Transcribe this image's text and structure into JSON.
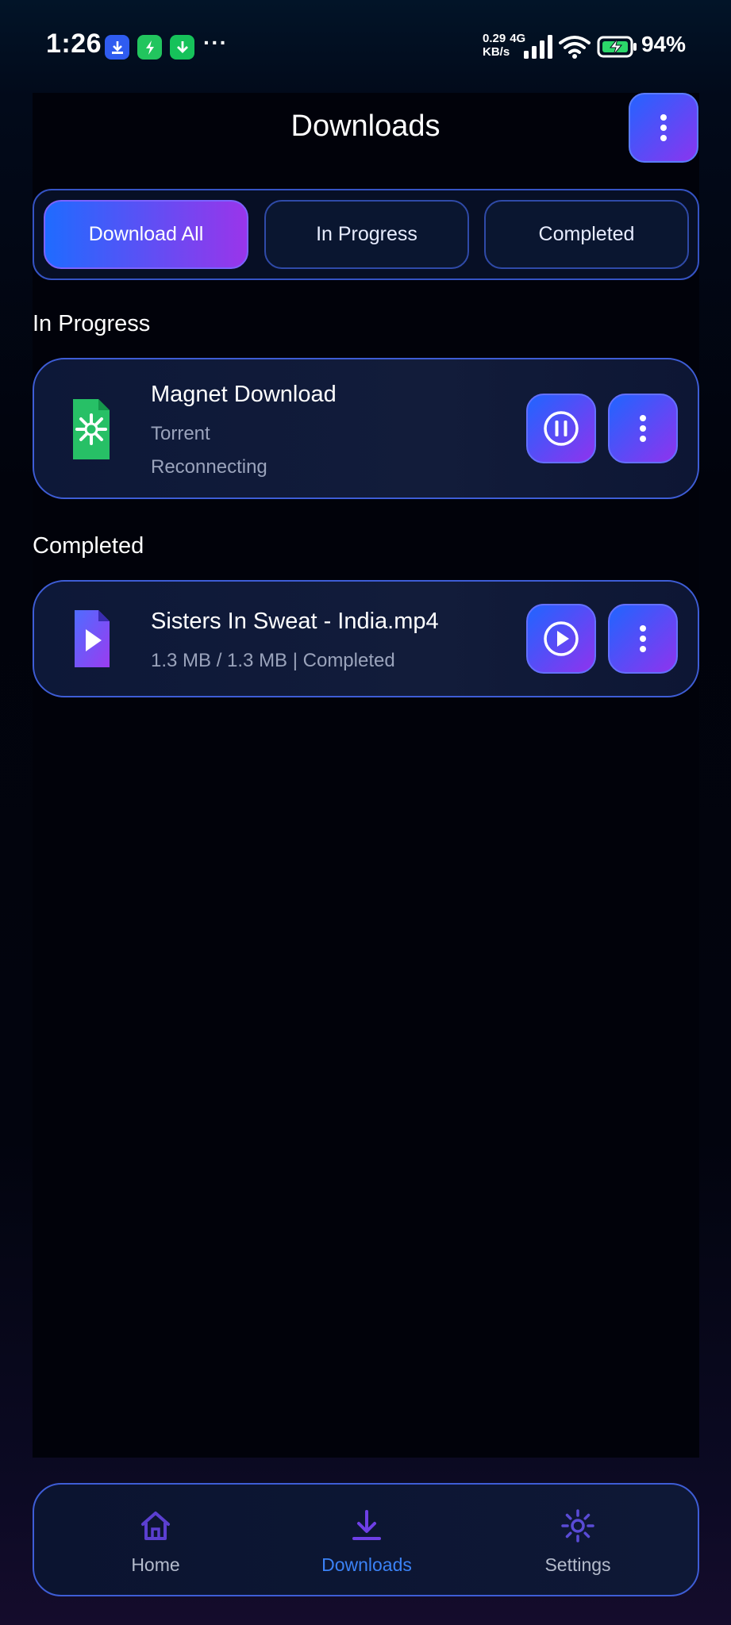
{
  "status_bar": {
    "time": "1:26",
    "overflow": "···",
    "net_speed_value": "0.29",
    "net_speed_unit": "KB/s",
    "network_type": "4G",
    "battery": "94%"
  },
  "header": {
    "title": "Downloads",
    "menu_icon": "more-vertical-icon"
  },
  "tabs": [
    {
      "label": "Download All",
      "active": true
    },
    {
      "label": "In Progress",
      "active": false
    },
    {
      "label": "Completed",
      "active": false
    }
  ],
  "sections": {
    "in_progress": {
      "heading": "In Progress",
      "items": [
        {
          "title": "Magnet Download",
          "type": "Torrent",
          "status": "Reconnecting",
          "icon": "torrent-file-icon",
          "action_icon": "pause-icon"
        }
      ]
    },
    "completed": {
      "heading": "Completed",
      "items": [
        {
          "title": "Sisters In Sweat - India.mp4",
          "detail": "1.3 MB / 1.3 MB | Completed",
          "icon": "video-file-icon",
          "action_icon": "play-icon"
        }
      ]
    }
  },
  "bottom_nav": [
    {
      "label": "Home",
      "icon": "home-icon",
      "active": false
    },
    {
      "label": "Downloads",
      "icon": "download-icon",
      "active": true
    },
    {
      "label": "Settings",
      "icon": "gear-icon",
      "active": false
    }
  ],
  "colors": {
    "accent_start": "#1f6bff",
    "accent_end": "#9a35ea",
    "border": "#3e5dd6",
    "active_nav": "#3b82f6"
  }
}
